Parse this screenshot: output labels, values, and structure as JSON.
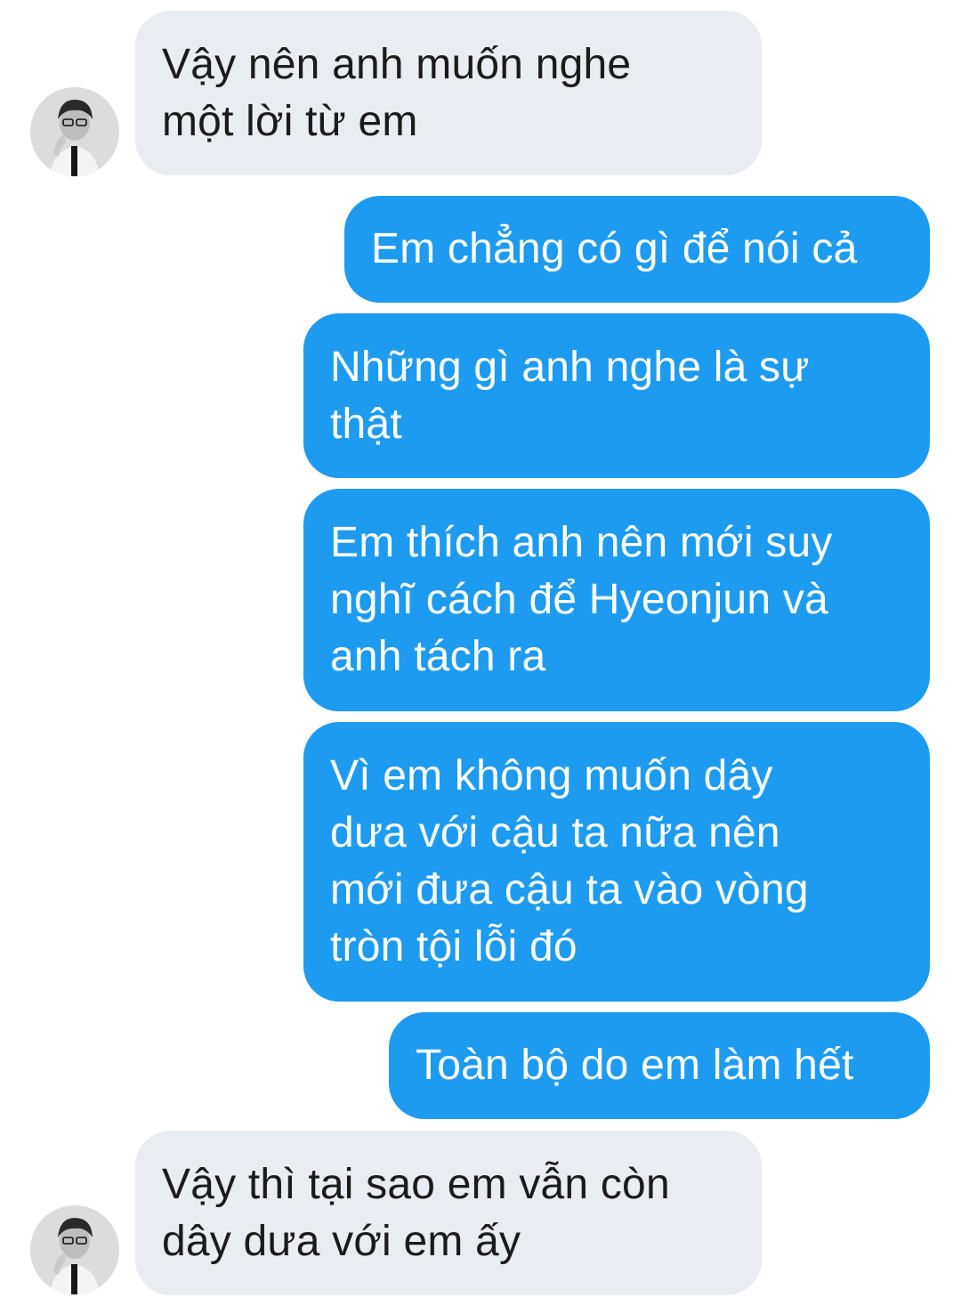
{
  "conversation": {
    "messages": [
      {
        "sender": "other",
        "text": "Vậy nên anh muốn nghe\nmột lời từ em"
      },
      {
        "sender": "me",
        "text": "Em chẳng có gì để nói cả"
      },
      {
        "sender": "me",
        "text": "Những gì anh nghe là sự\nthật"
      },
      {
        "sender": "me",
        "text": "Em thích anh nên mới suy\nnghĩ cách để Hyeonjun và\nanh tách ra"
      },
      {
        "sender": "me",
        "text": "Vì em không muốn dây\ndưa với cậu ta nữa nên\nmới đưa cậu ta vào vòng\ntròn tội lỗi đó"
      },
      {
        "sender": "me",
        "text": "Toàn bộ do em làm hết"
      },
      {
        "sender": "other",
        "text": "Vậy thì tại sao em vẫn còn\ndây dưa với em ấy"
      }
    ]
  },
  "colors": {
    "incoming_bubble": "#e9ecf0",
    "outgoing_bubble": "#1d9bf0",
    "incoming_text": "#1b1b1b",
    "outgoing_text": "#ffffff"
  },
  "icons": {
    "avatar": "contact-avatar-photo"
  }
}
